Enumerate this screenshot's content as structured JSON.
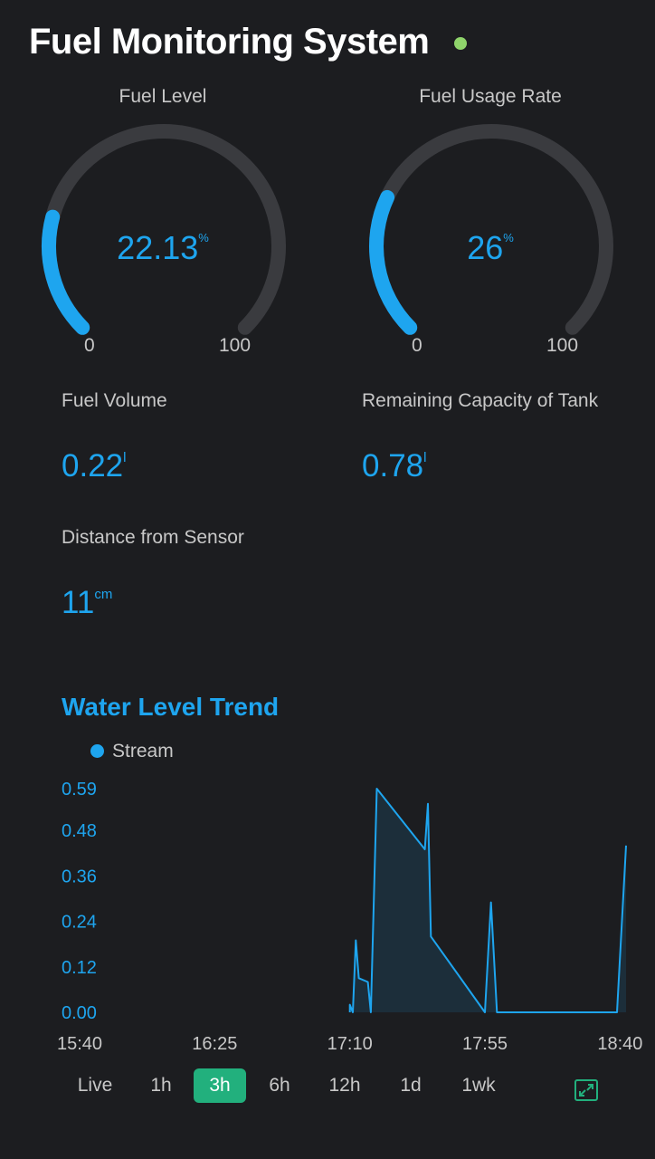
{
  "header": {
    "title": "Fuel Monitoring System",
    "status_color": "#8fd46b"
  },
  "gauges": [
    {
      "label": "Fuel Level",
      "value": "22.13",
      "unit": "%",
      "min": "0",
      "max": "100",
      "fraction": 0.2213
    },
    {
      "label": "Fuel Usage Rate",
      "value": "26",
      "unit": "%",
      "min": "0",
      "max": "100",
      "fraction": 0.26
    }
  ],
  "metrics": {
    "fuel_volume": {
      "label": "Fuel Volume",
      "value": "0.22",
      "unit": "l"
    },
    "remaining_capacity": {
      "label": "Remaining Capacity of Tank",
      "value": "0.78",
      "unit": "l"
    },
    "distance": {
      "label": "Distance from Sensor",
      "value": "11",
      "unit": "cm"
    }
  },
  "colors": {
    "accent": "#1ea5ef",
    "gauge_track": "#3a3b3f",
    "active_range": "#22b07d",
    "background": "#1c1d20"
  },
  "chart_data": {
    "type": "area",
    "title": "Water Level Trend",
    "series": [
      {
        "name": "Stream",
        "points": [
          [
            "17:10",
            0.0
          ],
          [
            "17:10",
            0.02
          ],
          [
            "17:11",
            0.0
          ],
          [
            "17:12",
            0.19
          ],
          [
            "17:13",
            0.09
          ],
          [
            "17:16",
            0.08
          ],
          [
            "17:17",
            0.0
          ],
          [
            "17:19",
            0.59
          ],
          [
            "17:35",
            0.43
          ],
          [
            "17:36",
            0.55
          ],
          [
            "17:37",
            0.2
          ],
          [
            "17:55",
            0.0
          ],
          [
            "17:57",
            0.29
          ],
          [
            "17:59",
            0.0
          ],
          [
            "18:39",
            0.0
          ],
          [
            "18:40",
            0.15
          ],
          [
            "18:42",
            0.44
          ]
        ]
      }
    ],
    "x_ticks": [
      "15:40",
      "16:25",
      "17:10",
      "17:55",
      "18:40"
    ],
    "y_ticks": [
      "0.00",
      "0.12",
      "0.24",
      "0.36",
      "0.48",
      "0.59"
    ],
    "ylim": [
      0,
      0.59
    ],
    "xlim": [
      "15:40",
      "18:42"
    ],
    "legend_position": "top-left",
    "grid": false
  },
  "time_ranges": {
    "options": [
      "Live",
      "1h",
      "3h",
      "6h",
      "12h",
      "1d",
      "1wk"
    ],
    "selected": "3h"
  },
  "icons": {
    "expand": "expand-icon"
  }
}
